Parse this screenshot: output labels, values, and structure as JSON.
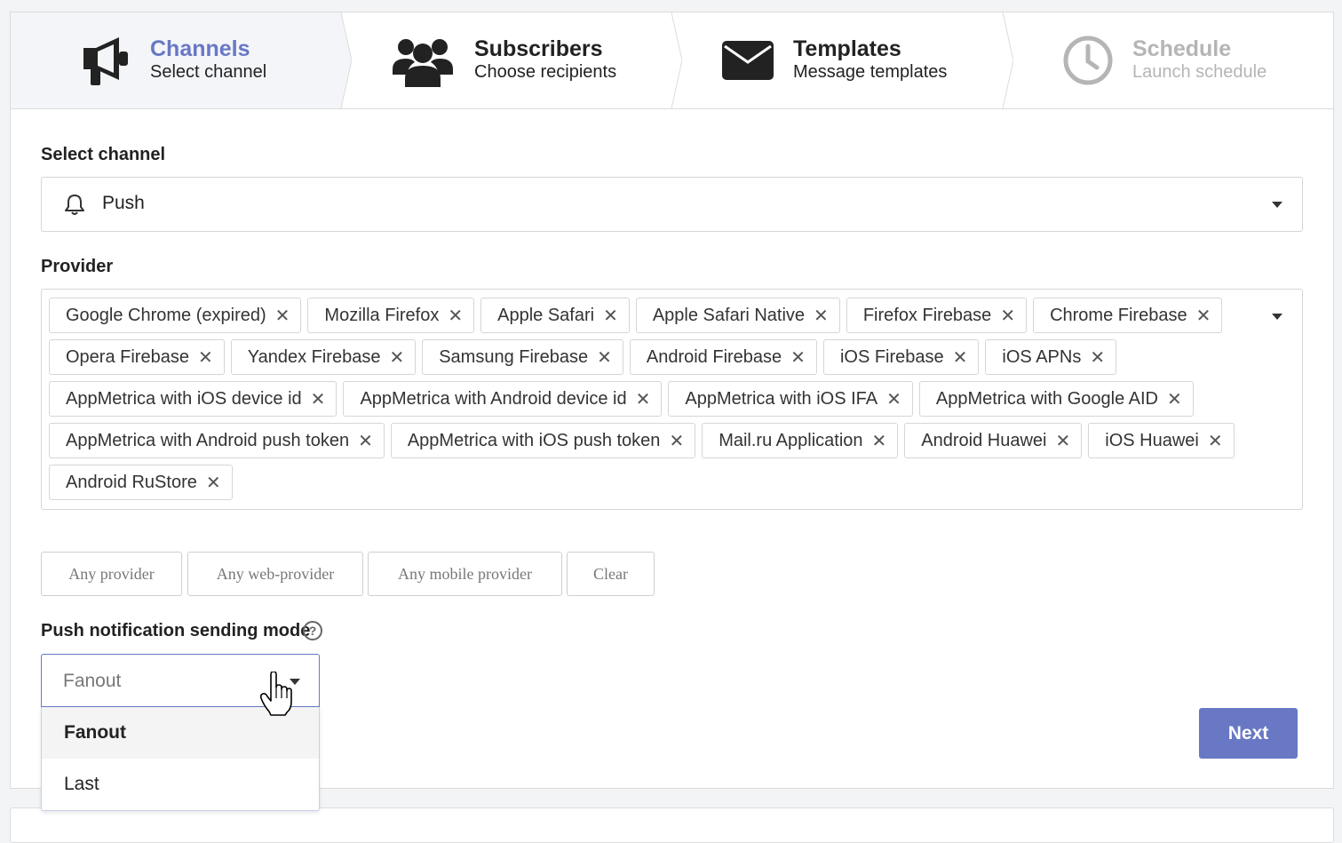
{
  "steps": [
    {
      "title": "Channels",
      "subtitle": "Select channel",
      "icon": "megaphone-icon",
      "state": "active"
    },
    {
      "title": "Subscribers",
      "subtitle": "Choose recipients",
      "icon": "users-icon",
      "state": "normal"
    },
    {
      "title": "Templates",
      "subtitle": "Message templates",
      "icon": "envelope-icon",
      "state": "normal"
    },
    {
      "title": "Schedule",
      "subtitle": "Launch schedule",
      "icon": "clock-icon",
      "state": "disabled"
    }
  ],
  "channel": {
    "label": "Select channel",
    "value": "Push",
    "icon": "bell-icon"
  },
  "provider": {
    "label": "Provider",
    "tags": [
      "Google Chrome (expired)",
      "Mozilla Firefox",
      "Apple Safari",
      "Apple Safari Native",
      "Firefox Firebase",
      "Chrome Firebase",
      "Opera Firebase",
      "Yandex Firebase",
      "Samsung Firebase",
      "Android Firebase",
      "iOS Firebase",
      "iOS APNs",
      "AppMetrica with iOS device id",
      "AppMetrica with Android device id",
      "AppMetrica with iOS IFA",
      "AppMetrica with Google AID",
      "AppMetrica with Android push token",
      "AppMetrica with iOS push token",
      "Mail.ru Application",
      "Android Huawei",
      "iOS Huawei",
      "Android RuStore"
    ],
    "remove_glyph": "✕"
  },
  "quick_buttons": {
    "any_provider": "Any provider",
    "any_web": "Any web-provider",
    "any_mobile": "Any mobile provider",
    "clear": "Clear"
  },
  "mode": {
    "label": "Push notification sending mode",
    "help": "?",
    "value": "Fanout",
    "options": [
      "Fanout",
      "Last"
    ],
    "selected": "Fanout"
  },
  "next_label": "Next",
  "colors": {
    "accent": "#6878c4",
    "border": "#d6d6d6"
  }
}
